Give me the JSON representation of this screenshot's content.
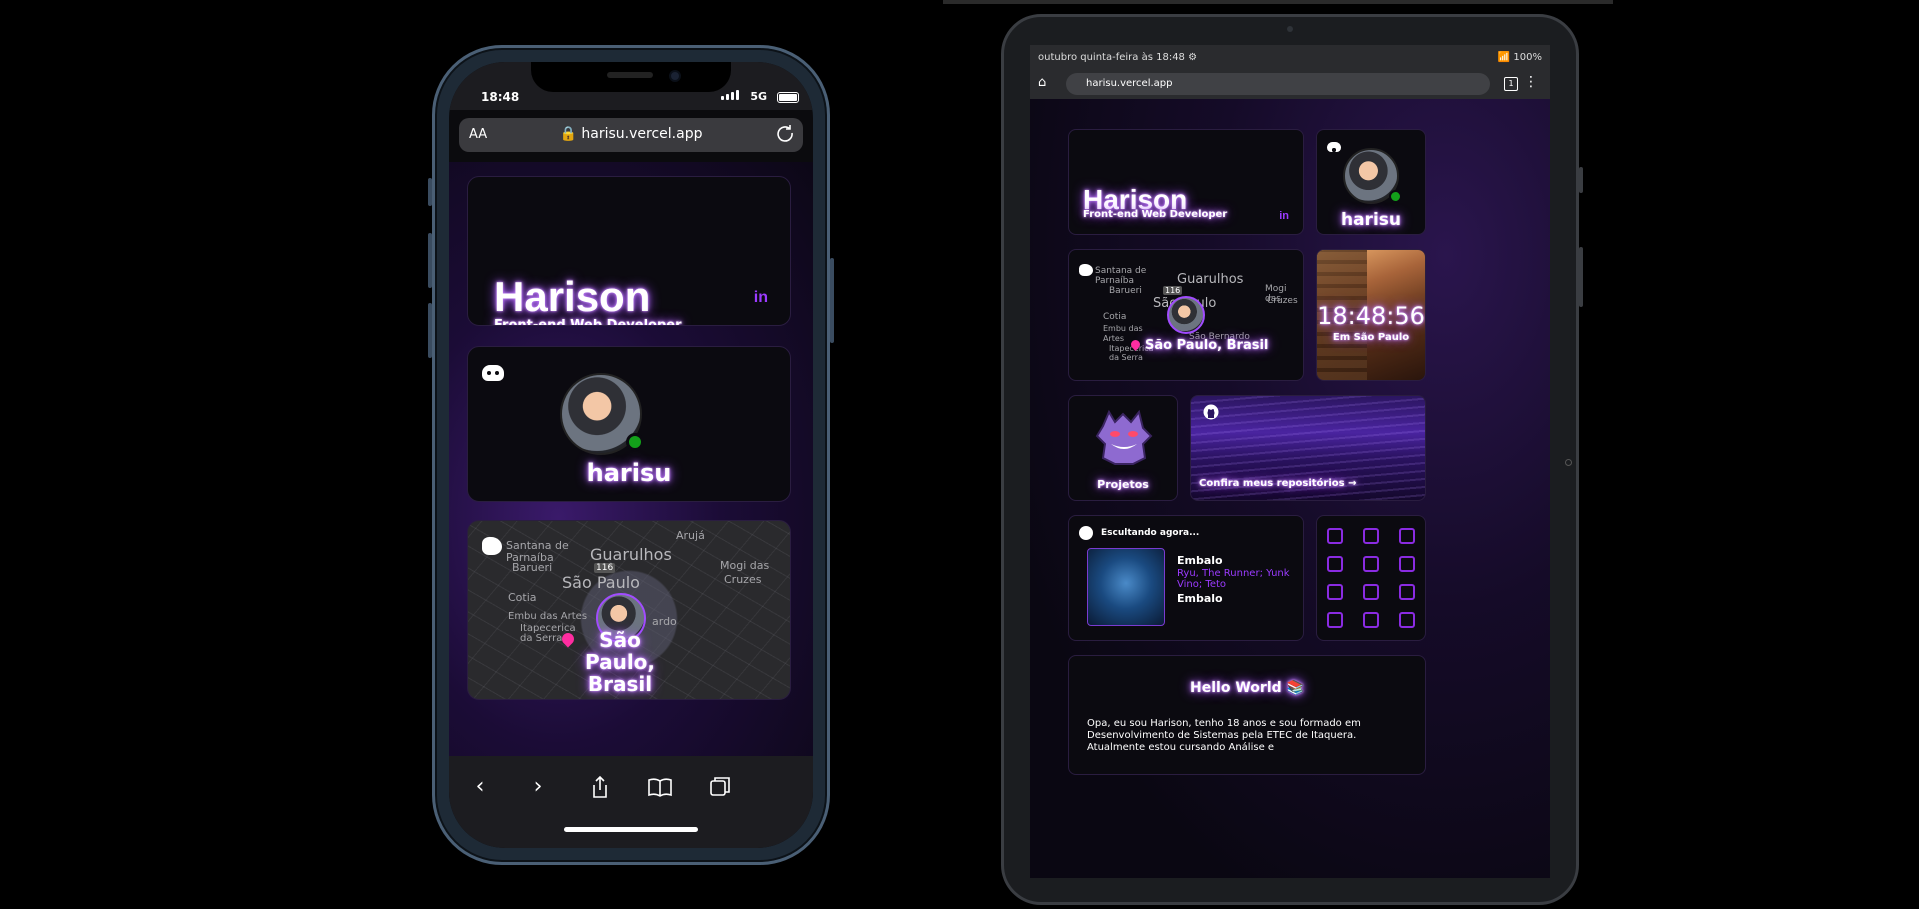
{
  "phone": {
    "status": {
      "time": "18:48",
      "network": "5G"
    },
    "url_bar": {
      "text_size_label": "AA",
      "url": "harisu.vercel.app"
    },
    "profile": {
      "name": "Harison",
      "role": "Front-end Web Developer",
      "linkedin_label": "in"
    },
    "discord": {
      "username": "harisu"
    },
    "map": {
      "location_line1": "São Paulo,",
      "location_line2": "Brasil",
      "labels": [
        "Santana de",
        "Parnaíba",
        "Barueri",
        "Guarulhos",
        "São Paulo",
        "Cotia",
        "Embu das Artes",
        "Itapecerica",
        "da Serra",
        "Mogi das",
        "Cruzes",
        "Arujá",
        "116",
        "ardo"
      ]
    },
    "toolbar": {
      "back": "‹",
      "forward": "›"
    }
  },
  "tablet": {
    "status": {
      "left": "outubro quinta-feira às 18:48 ⚙",
      "right": "📶 100%"
    },
    "url_bar": {
      "url": "harisu.vercel.app",
      "tabs_count": "1"
    },
    "profile": {
      "name": "Harison",
      "role": "Front-end Web Developer",
      "linkedin_label": "in"
    },
    "discord": {
      "username": "harisu"
    },
    "map": {
      "location": "São Paulo, Brasil",
      "labels": [
        "Santana de",
        "Parnaíba",
        "Barueri",
        "Guarulhos",
        "São Paulo",
        "Cotia",
        "Embu das",
        "Artes",
        "Itapecerica",
        "da Serra",
        "Mogi das",
        "Cruzes",
        "116",
        "São Bernardo"
      ]
    },
    "clock": {
      "time": "18:48:56",
      "caption": "Em São Paulo"
    },
    "projects": {
      "label": "Projetos"
    },
    "github": {
      "label": "Confira meus repositórios →"
    },
    "spotify": {
      "heading": "Escultando agora...",
      "track": "Embalo",
      "artists": "Ryu, The Runner; Yunk Vino; Teto",
      "album": "Embalo"
    },
    "hello": {
      "title": "Hello World 📚",
      "text": "Opa, eu sou Harison, tenho 18 anos e sou formado em Desenvolvimento de Sistemas pela ETEC de Itaquera. Atualmente estou cursando Análise e"
    },
    "tech_icons": [
      "html5-icon",
      "css3-icon",
      "javascript-icon",
      "typescript-icon",
      "react-icon",
      "nodejs-icon",
      "vue-icon",
      "nextjs-icon",
      "tailwind-icon",
      "sass-icon",
      "git-icon",
      "github-icon",
      "bootstrap-icon",
      "styled-components-icon",
      "vscode-icon"
    ]
  },
  "colors": {
    "accent": "#9b3bff",
    "glow": "#c27bff",
    "online": "#13a01a",
    "pin": "#ff2da0"
  }
}
